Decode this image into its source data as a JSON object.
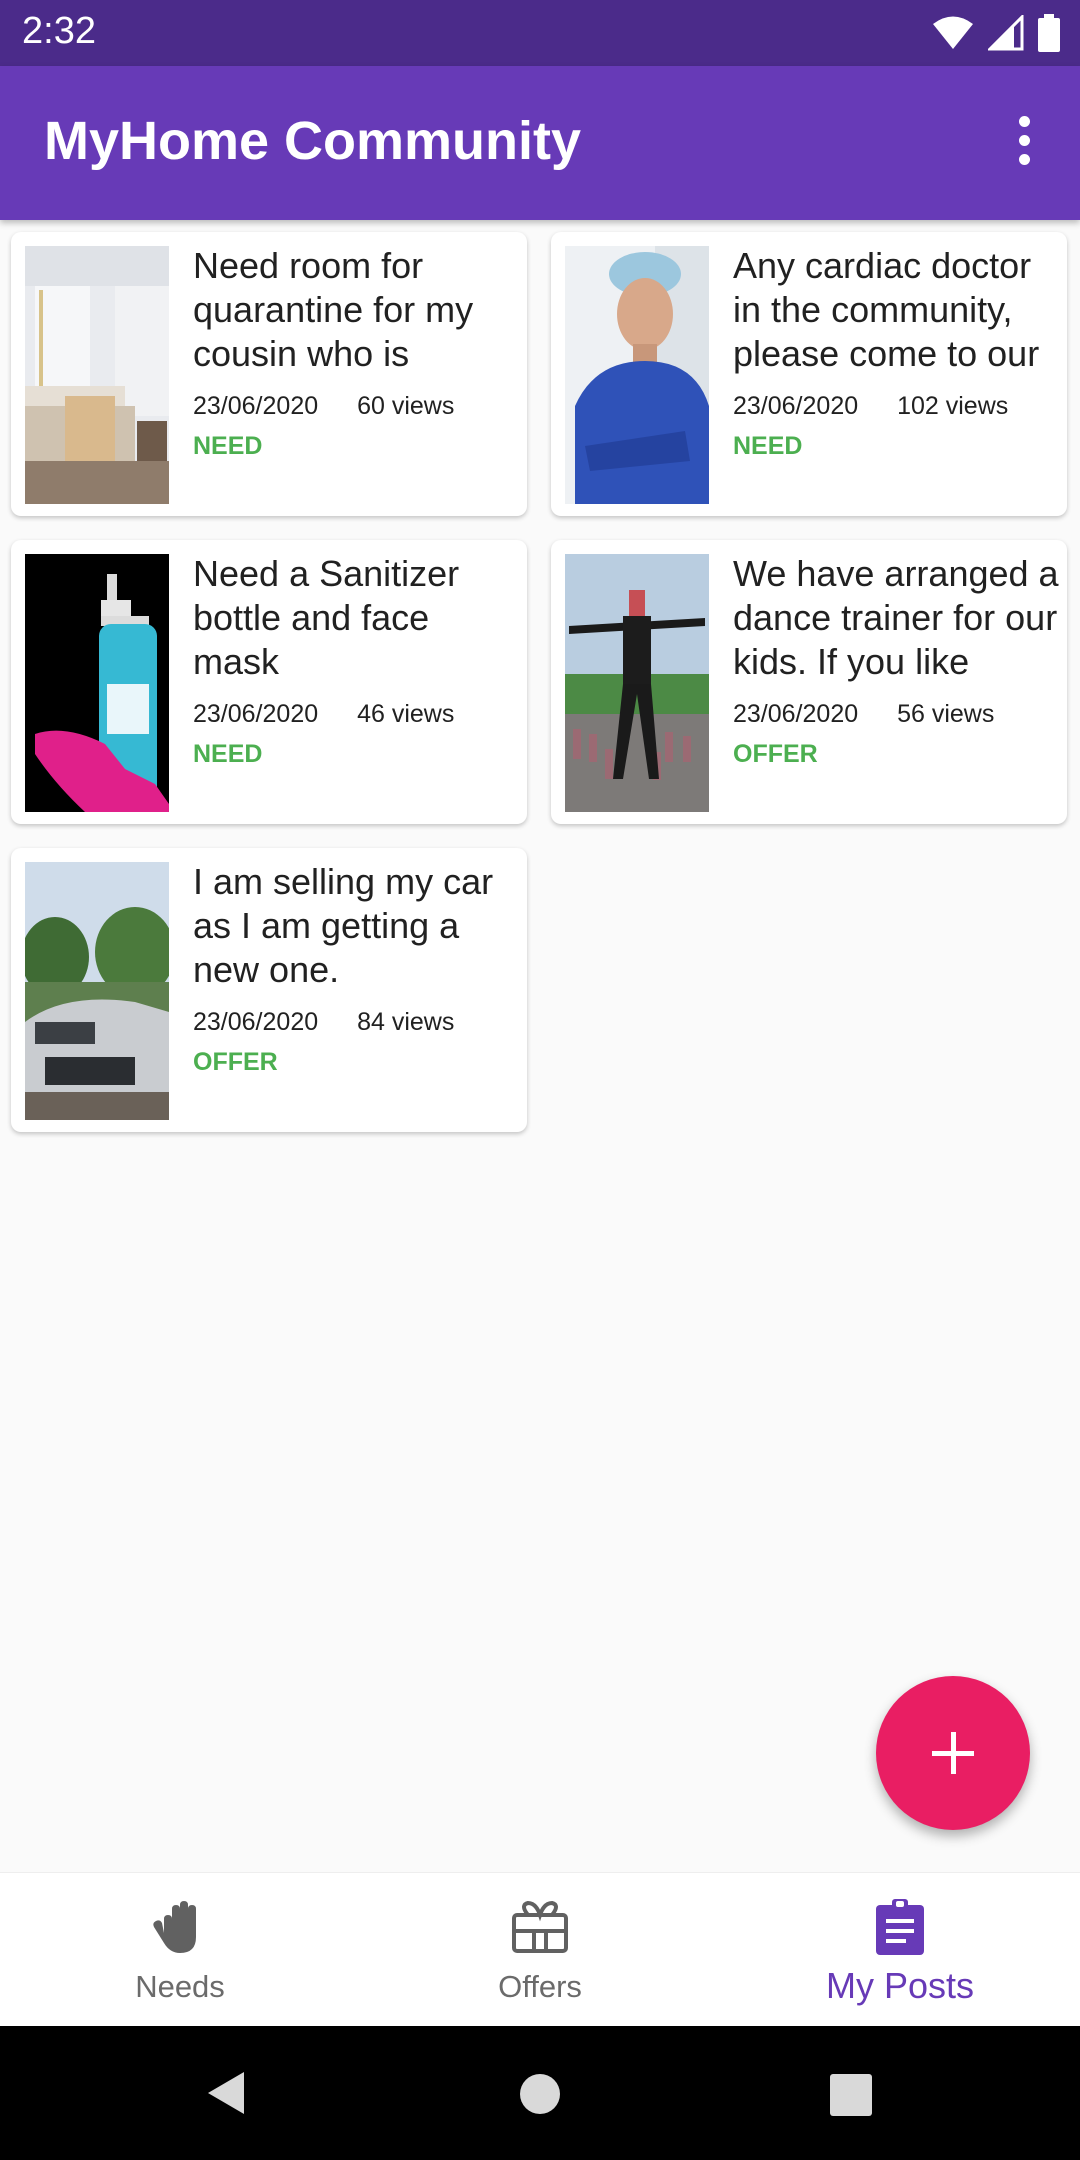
{
  "status_bar": {
    "time": "2:32"
  },
  "app_bar": {
    "title": "MyHome Community"
  },
  "posts": [
    {
      "title": "Need room for quarantine for my cousin who is",
      "date": "23/06/2020",
      "views": "60 views",
      "tag": "NEED"
    },
    {
      "title": "Any cardiac doctor in the community, please come to our",
      "date": "23/06/2020",
      "views": "102 views",
      "tag": "NEED"
    },
    {
      "title": "Need a Sanitizer bottle and face mask",
      "date": "23/06/2020",
      "views": "46 views",
      "tag": "NEED"
    },
    {
      "title": "We have arranged a dance trainer for our kids. If you like",
      "date": "23/06/2020",
      "views": "56 views",
      "tag": "OFFER"
    },
    {
      "title": "I am selling my car as I am getting a new one.",
      "date": "23/06/2020",
      "views": "84 views",
      "tag": "OFFER"
    }
  ],
  "fab": {
    "icon": "plus-icon"
  },
  "bottom_nav": {
    "items": [
      {
        "label": "Needs",
        "icon": "hand-icon"
      },
      {
        "label": "Offers",
        "icon": "gift-icon"
      },
      {
        "label": "My Posts",
        "icon": "clipboard-icon"
      }
    ],
    "active": "My Posts"
  },
  "colors": {
    "primary": "#673ab7",
    "status_bar": "#4b2b8a",
    "accent": "#e91e63",
    "tag_green": "#4caf50"
  }
}
